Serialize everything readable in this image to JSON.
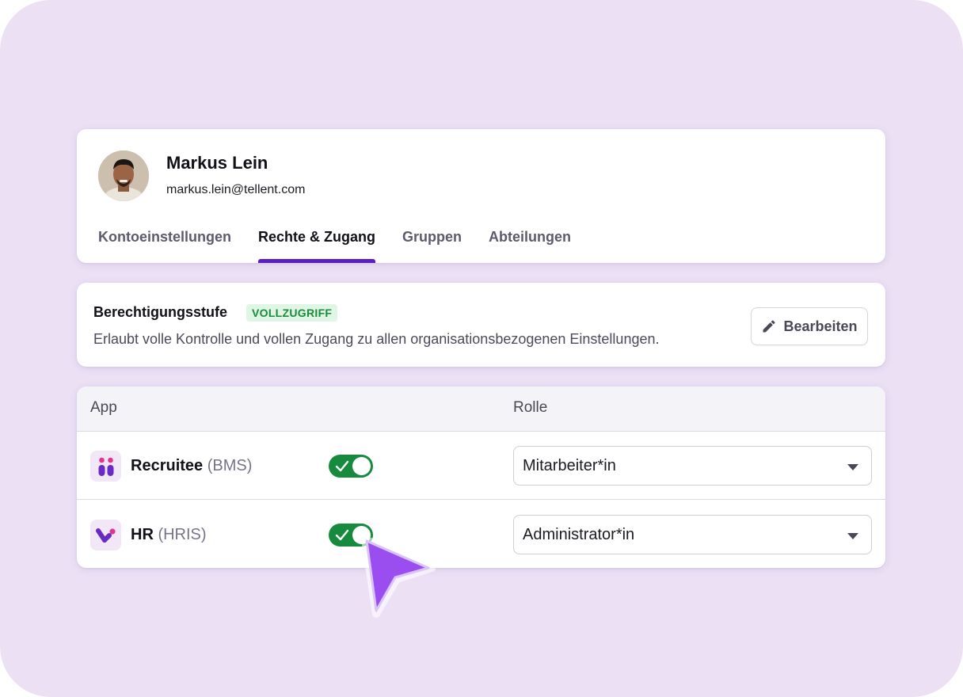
{
  "profile": {
    "name": "Markus Lein",
    "email": "markus.lein@tellent.com"
  },
  "tabs": [
    {
      "label": "Kontoeinstellungen",
      "active": false
    },
    {
      "label": "Rechte & Zugang",
      "active": true
    },
    {
      "label": "Gruppen",
      "active": false
    },
    {
      "label": "Abteilungen",
      "active": false
    }
  ],
  "permission": {
    "title": "Berechtigungsstufe",
    "badge": "VOLLZUGRIFF",
    "description": "Erlaubt volle Kontrolle und vollen Zugang zu allen organisationsbezogenen Einstellungen.",
    "edit_label": "Bearbeiten"
  },
  "table": {
    "headers": {
      "app": "App",
      "role": "Rolle"
    },
    "rows": [
      {
        "app": "Recruitee",
        "code": "(BMS)",
        "enabled": true,
        "role": "Mitarbeiter*in",
        "icon": "recruitee-logo-icon"
      },
      {
        "app": "HR",
        "code": "(HRIS)",
        "enabled": true,
        "role": "Administrator*in",
        "icon": "hr-logo-icon"
      }
    ]
  },
  "colors": {
    "background": "#ece0f5",
    "accent": "#5a1fbf",
    "toggle_on": "#168a3d",
    "badge_bg": "#dff6e4",
    "badge_text": "#1b8a3c",
    "cursor": "#9b4ef0"
  }
}
